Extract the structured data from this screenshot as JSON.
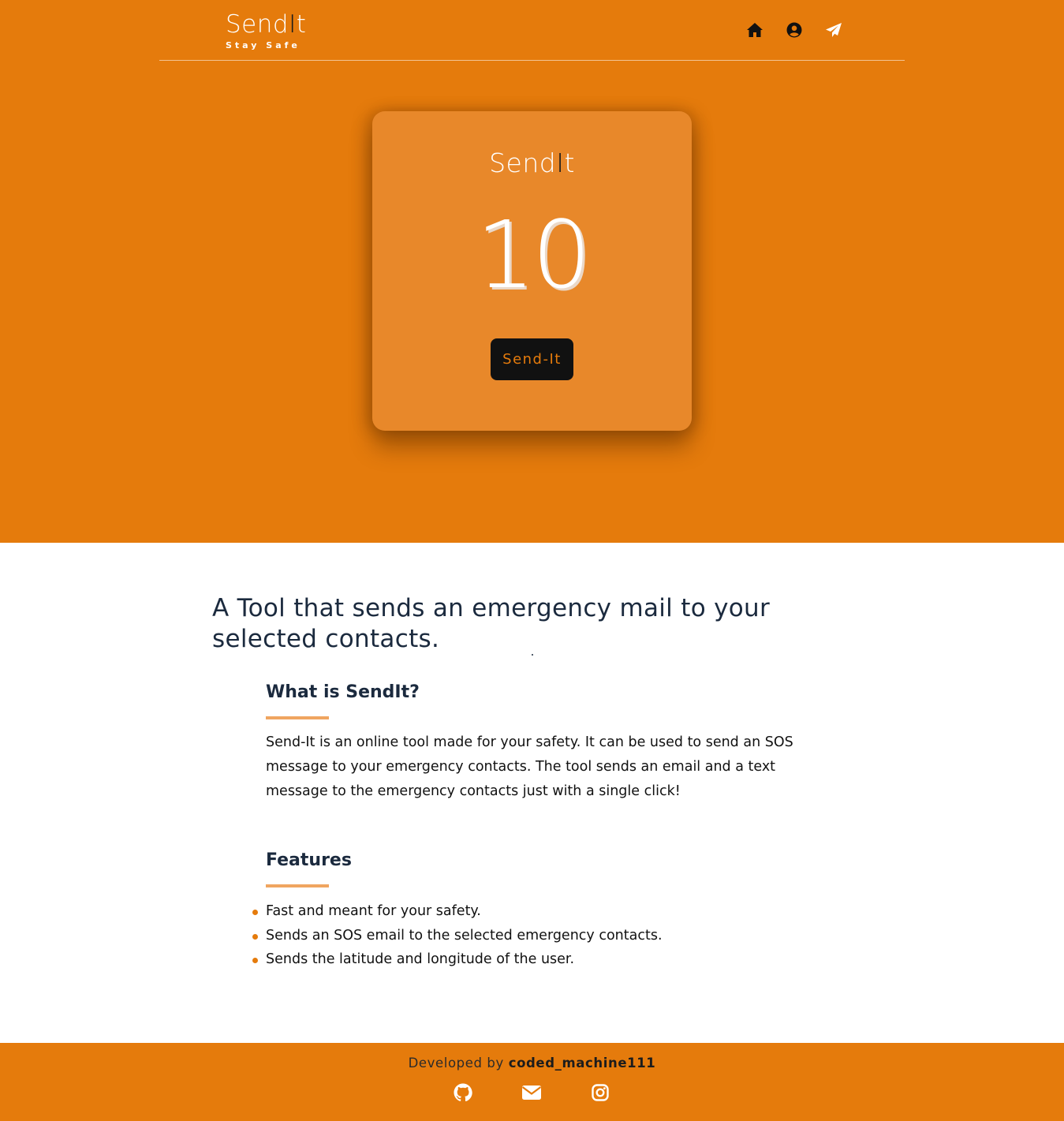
{
  "nav": {
    "brand_left": "Send",
    "brand_bar": "I",
    "brand_right": "t",
    "tagline": "Stay Safe",
    "icons": [
      "home-icon",
      "user-circle-icon",
      "paper-plane-icon"
    ]
  },
  "card": {
    "brand_left": "Send",
    "brand_bar": "I",
    "brand_right": "t",
    "countdown": "10",
    "button_label": "Send-It"
  },
  "main": {
    "headline": "A Tool that sends an emergency mail to your selected contacts.",
    "about_title": "What is SendIt?",
    "about_text": "Send-It is an online tool made for your safety. It can be used to send an SOS message to your emergency contacts. The tool sends an email and a text message to the emergency contacts just with a single click!",
    "features_title": "Features",
    "features": [
      "Fast and meant for your safety.",
      "Sends an SOS email to the selected emergency contacts.",
      "Sends the latitude and longitude of the user."
    ]
  },
  "footer": {
    "developed_by": "Developed by ",
    "developer": "coded_machine111",
    "icons": [
      "github-icon",
      "envelope-icon",
      "instagram-icon"
    ]
  },
  "colors": {
    "accent": "#e57b0c",
    "card": "#e8882a",
    "dark": "#111111",
    "heading": "#1b2a3e",
    "underline": "#f0a560"
  }
}
